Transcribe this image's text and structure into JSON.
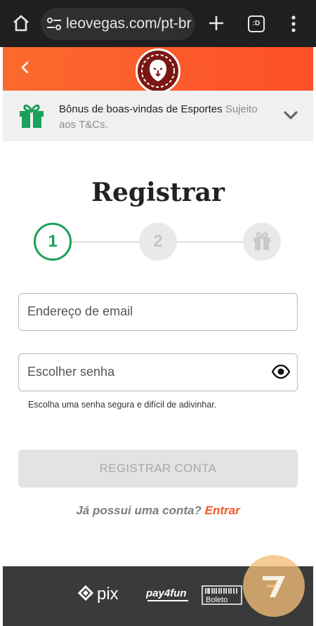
{
  "browser": {
    "url": "leovegas.com/pt-br",
    "tabs_count": ":D"
  },
  "header": {
    "logo": "leovegas-lion-logo"
  },
  "bonus": {
    "title": "Bônus de boas-vindas de Esportes",
    "terms": "Sujeito aos T&Cs."
  },
  "register": {
    "title": "Registrar",
    "steps": [
      "1",
      "2"
    ],
    "email_placeholder": "Endereço de email",
    "password_placeholder": "Escolher senha",
    "password_hint": "Escolha uma senha segura e difícil de adivinhar.",
    "submit_label": "REGISTRAR CONTA",
    "login_question": "Já possui uma conta?",
    "login_link": "Entrar"
  },
  "footer": {
    "payments": [
      "pix",
      "pay4fun",
      "Boleto"
    ]
  },
  "colors": {
    "brand_orange": "#fd5a2a",
    "step_green": "#1aa05a",
    "link_orange": "#f0582a"
  }
}
